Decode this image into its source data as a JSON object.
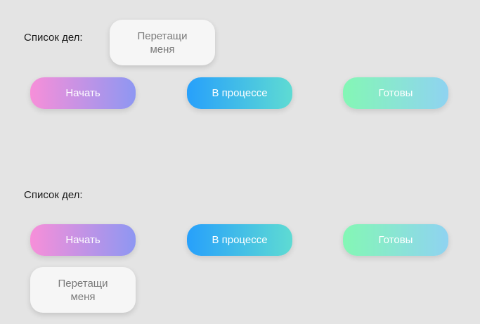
{
  "sections": [
    {
      "label": "Список дел:",
      "drag_card": "Перетащи меня",
      "buttons": {
        "start": "Начать",
        "in_progress": "В процессе",
        "done": "Готовы"
      }
    },
    {
      "label": "Список дел:",
      "drag_card": "Перетащи меня",
      "buttons": {
        "start": "Начать",
        "in_progress": "В процессе",
        "done": "Готовы"
      }
    }
  ],
  "colors": {
    "background": "#e4e4e4",
    "start_gradient": [
      "#f78fd9",
      "#8e97f2"
    ],
    "in_progress_gradient": [
      "#27a0fb",
      "#5edbd3"
    ],
    "done_gradient": [
      "#84f7b5",
      "#8fd3f1"
    ],
    "card": "#f6f6f6"
  }
}
